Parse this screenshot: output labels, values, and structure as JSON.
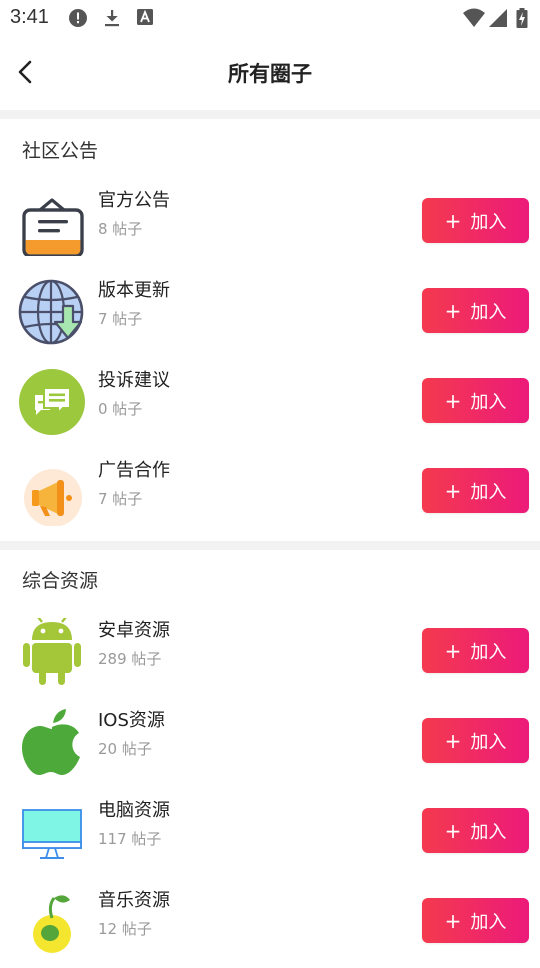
{
  "status_bar": {
    "time": "3:41",
    "left_icons": [
      "alert-icon",
      "download-icon",
      "font-icon"
    ],
    "right_icons": [
      "wifi-icon",
      "signal-icon",
      "battery-charging-icon"
    ]
  },
  "header": {
    "title": "所有圈子",
    "back_icon": "chevron-left-icon"
  },
  "join_label": "加入",
  "join_icon": "plus-icon",
  "accent": {
    "gradient_start": "#f43a4e",
    "gradient_end": "#ec1a7a"
  },
  "sections": [
    {
      "title": "社区公告",
      "items": [
        {
          "name": "官方公告",
          "count": "8 帖子",
          "icon": "notice-board-icon"
        },
        {
          "name": "版本更新",
          "count": "7 帖子",
          "icon": "globe-download-icon"
        },
        {
          "name": "投诉建议",
          "count": "0 帖子",
          "icon": "chat-bubbles-icon"
        },
        {
          "name": "广告合作",
          "count": "7 帖子",
          "icon": "megaphone-icon"
        }
      ]
    },
    {
      "title": "综合资源",
      "items": [
        {
          "name": "安卓资源",
          "count": "289 帖子",
          "icon": "android-icon"
        },
        {
          "name": "IOS资源",
          "count": "20 帖子",
          "icon": "apple-icon"
        },
        {
          "name": "电脑资源",
          "count": "117 帖子",
          "icon": "monitor-icon"
        },
        {
          "name": "音乐资源",
          "count": "12 帖子",
          "icon": "music-sprout-icon"
        }
      ]
    }
  ]
}
